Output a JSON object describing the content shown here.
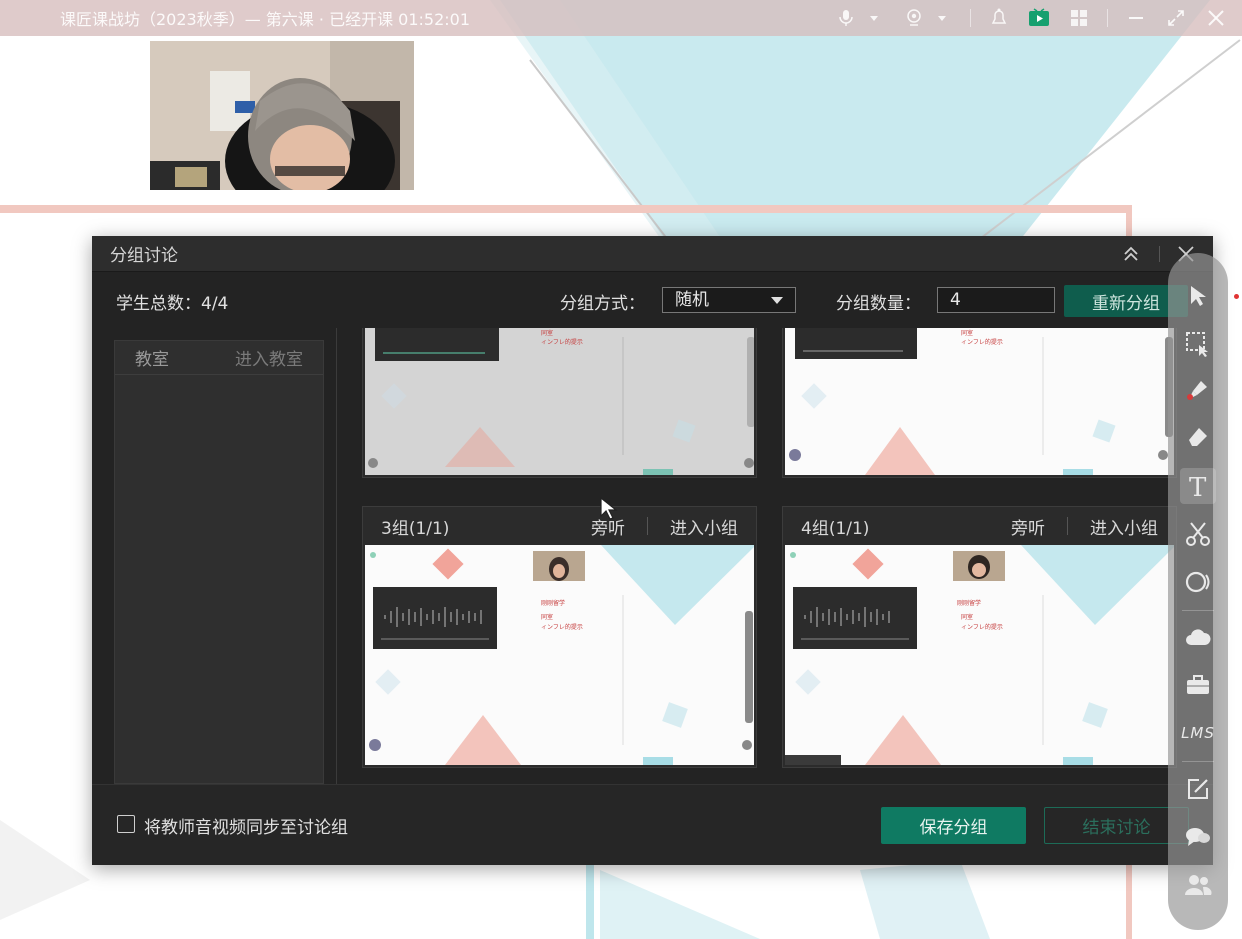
{
  "app": {
    "title": "课匠课战坊（2023秋季）— 第六课 · 已经开课 01:52:01"
  },
  "dialog": {
    "title": "分组讨论",
    "student_total_label": "学生总数：4/4",
    "group_method_label": "分组方式：",
    "group_method_value": "随机",
    "group_count_label": "分组数量：",
    "group_count_value": "4",
    "regroup_label": "重新分组",
    "rooms_header": {
      "name": "教室",
      "enter": "进入教室"
    },
    "groups": [
      {
        "name": "",
        "listen": "",
        "enter": ""
      },
      {
        "name": "",
        "listen": "",
        "enter": ""
      },
      {
        "name": "3组(1/1)",
        "listen": "旁听",
        "enter": "进入小组"
      },
      {
        "name": "4组(1/1)",
        "listen": "旁听",
        "enter": "进入小组"
      }
    ],
    "sync_av_label": "将教师音视频同步至讨论组",
    "save_label": "保存分组",
    "end_label": "结束讨论"
  },
  "toolbar_icons": [
    "pointer-icon",
    "select-icon",
    "pen-icon",
    "eraser-icon",
    "text-icon",
    "scissors-icon",
    "shape-icon",
    "cloud-icon",
    "toolbox-icon",
    "lms-icon",
    "edit-icon",
    "chat-icon",
    "users-icon"
  ],
  "palette_lms": "LMS",
  "palette_text_tool": "T",
  "colors": {
    "accent": "#0f7a62",
    "dialog_bg": "#232323",
    "teal_bg": "#a8dde6",
    "salmon_bg": "#e8a39a"
  }
}
